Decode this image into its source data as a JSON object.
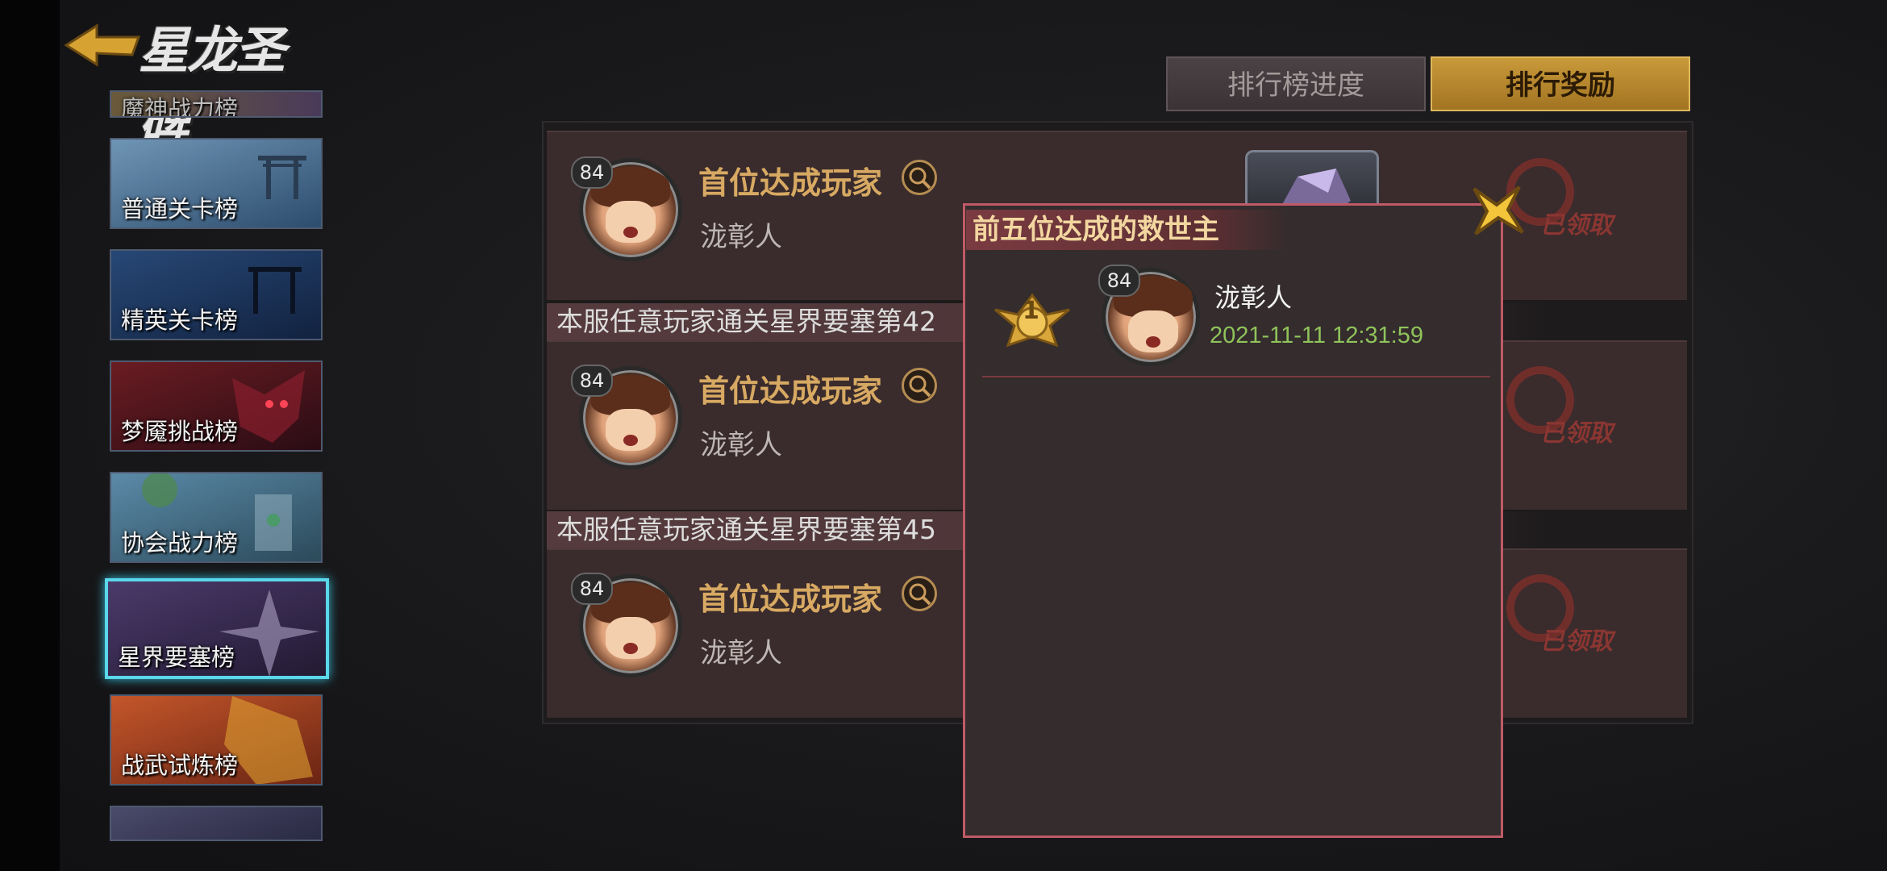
{
  "header": {
    "title": "星龙圣碑"
  },
  "sidebar": {
    "items": [
      {
        "label": "魔神战力榜",
        "color": "#5a4a6a"
      },
      {
        "label": "普通关卡榜",
        "color": "#3a5a78"
      },
      {
        "label": "精英关卡榜",
        "color": "#1c3258"
      },
      {
        "label": "梦魇挑战榜",
        "color": "#5a1a22"
      },
      {
        "label": "协会战力榜",
        "color": "#3b5670"
      },
      {
        "label": "星界要塞榜",
        "color": "#3c3050",
        "active": true
      },
      {
        "label": "战武试炼榜",
        "color": "#8a3a22"
      },
      {
        "label": "",
        "color": "#3a3a55"
      }
    ]
  },
  "tabs": [
    {
      "label": "排行榜进度",
      "active": false
    },
    {
      "label": "排行奖励",
      "active": true
    }
  ],
  "entries": [
    {
      "heading": "",
      "badge": "首位达成玩家",
      "player": "泷彰人",
      "level": "84",
      "status": "已领取"
    },
    {
      "heading": "本服任意玩家通关星界要塞第42",
      "badge": "首位达成玩家",
      "player": "泷彰人",
      "level": "84",
      "status": "已领取"
    },
    {
      "heading": "本服任意玩家通关星界要塞第45",
      "badge": "首位达成玩家",
      "player": "泷彰人",
      "level": "84",
      "status": "已领取"
    }
  ],
  "popup": {
    "title": "前五位达成的救世主",
    "rows": [
      {
        "rank": "1",
        "level": "84",
        "player": "泷彰人",
        "time": "2021-11-11  12:31:59"
      }
    ]
  },
  "colors": {
    "accent_gold": "#d7a962",
    "time_green": "#8fc35a",
    "popup_border": "#c05a66",
    "active_cyan": "#5ad7ea"
  }
}
